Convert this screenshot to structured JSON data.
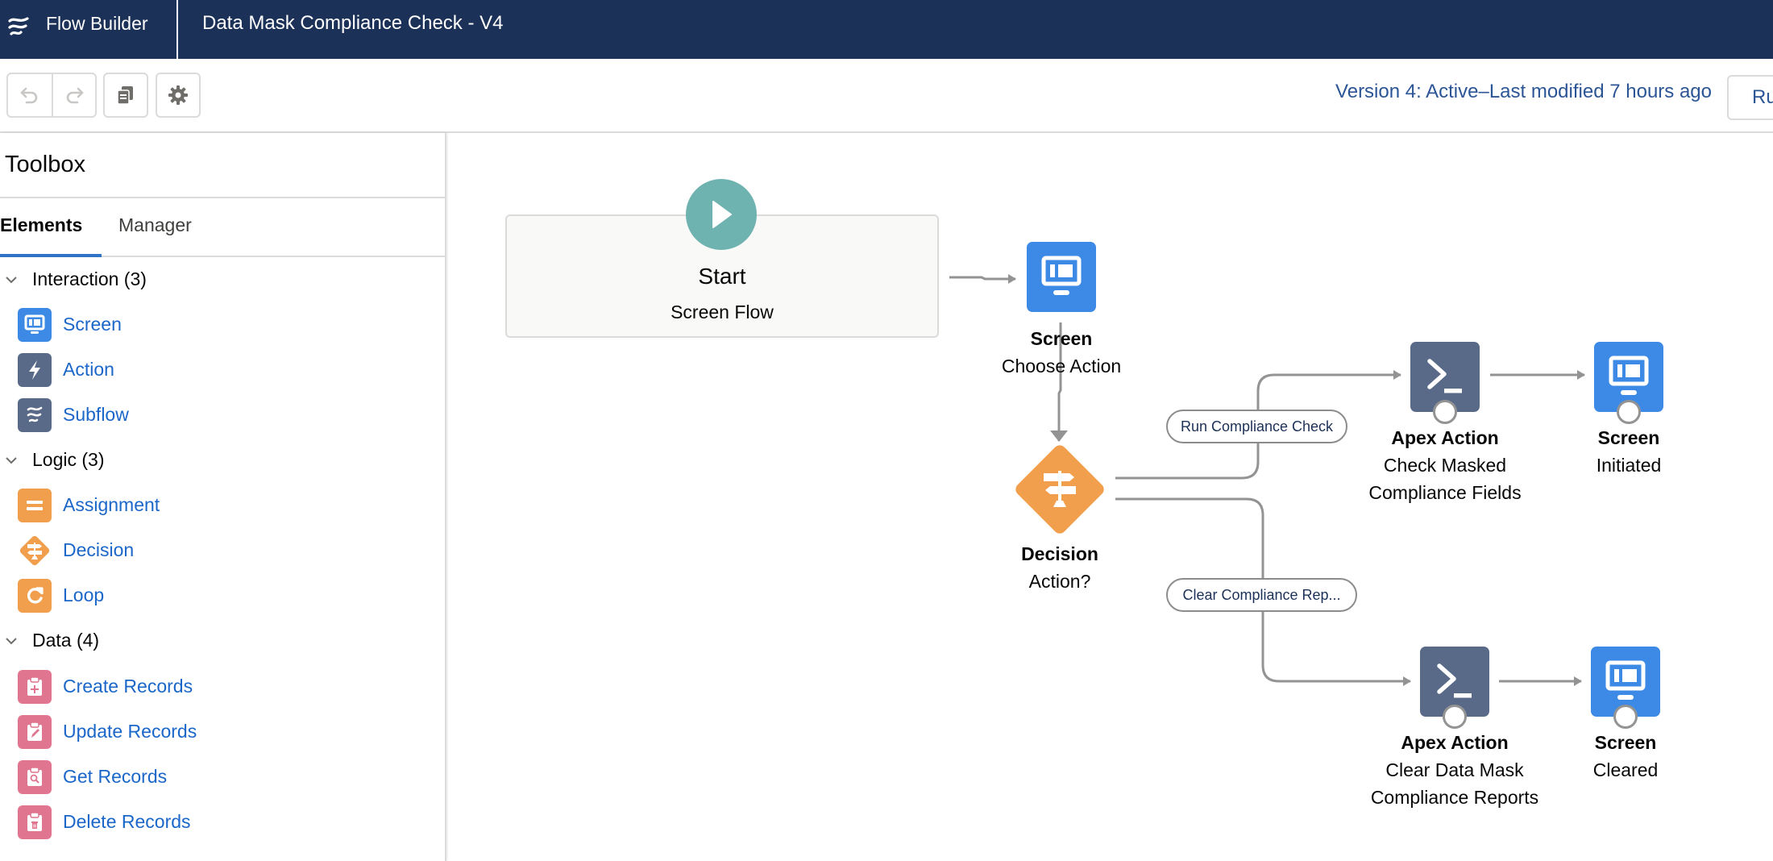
{
  "header": {
    "app_name": "Flow Builder",
    "flow_title": "Data Mask Compliance Check - V4",
    "logo_icon": "flow-icon"
  },
  "toolbar": {
    "undo_icon": "undo-icon",
    "redo_icon": "redo-icon",
    "copy_icon": "copy-icon",
    "settings_icon": "gear-icon",
    "version_status": "Version 4: Active–Last modified 7 hours ago",
    "run_label": "Run"
  },
  "sidebar": {
    "title": "Toolbox",
    "tabs": [
      {
        "label": "Elements",
        "active": true
      },
      {
        "label": "Manager",
        "active": false
      }
    ],
    "sections": [
      {
        "label": "Interaction (3)",
        "items": [
          {
            "label": "Screen",
            "icon": "screen-icon",
            "color": "#3d8ae6"
          },
          {
            "label": "Action",
            "icon": "lightning-icon",
            "color": "#596a89"
          },
          {
            "label": "Subflow",
            "icon": "flow-icon",
            "color": "#596a89"
          }
        ]
      },
      {
        "label": "Logic (3)",
        "items": [
          {
            "label": "Assignment",
            "icon": "assignment-icon",
            "color": "#f19f4d"
          },
          {
            "label": "Decision",
            "icon": "decision-icon",
            "color": "#f19f4d"
          },
          {
            "label": "Loop",
            "icon": "loop-icon",
            "color": "#f19f4d"
          }
        ]
      },
      {
        "label": "Data (4)",
        "items": [
          {
            "label": "Create Records",
            "icon": "record-create-icon",
            "color": "#e0758f"
          },
          {
            "label": "Update Records",
            "icon": "record-update-icon",
            "color": "#e0758f"
          },
          {
            "label": "Get Records",
            "icon": "record-lookup-icon",
            "color": "#e0758f"
          },
          {
            "label": "Delete Records",
            "icon": "record-delete-icon",
            "color": "#e0758f"
          }
        ]
      }
    ]
  },
  "canvas": {
    "start": {
      "title": "Start",
      "subtitle": "Screen Flow",
      "color": "#6fb3b1"
    },
    "nodes": [
      {
        "id": "choose_action",
        "type": "Screen",
        "name": "Choose Action",
        "color": "#3d8ae6"
      },
      {
        "id": "decision",
        "type": "Decision",
        "name": "Action?",
        "color": "#f19f4d"
      },
      {
        "id": "check_masked",
        "type": "Apex Action",
        "name_lines": [
          "Check Masked",
          "Compliance Fields"
        ],
        "color": "#596a89"
      },
      {
        "id": "initiated",
        "type": "Screen",
        "name": "Initiated",
        "color": "#3d8ae6"
      },
      {
        "id": "clear_reports",
        "type": "Apex Action",
        "name_lines": [
          "Clear Data Mask",
          "Compliance Reports"
        ],
        "color": "#596a89"
      },
      {
        "id": "cleared",
        "type": "Screen",
        "name": "Cleared",
        "color": "#3d8ae6"
      }
    ],
    "outcomes": [
      {
        "label": "Run Compliance Check"
      },
      {
        "label": "Clear Compliance Rep..."
      }
    ],
    "connector_color": "#939393"
  }
}
